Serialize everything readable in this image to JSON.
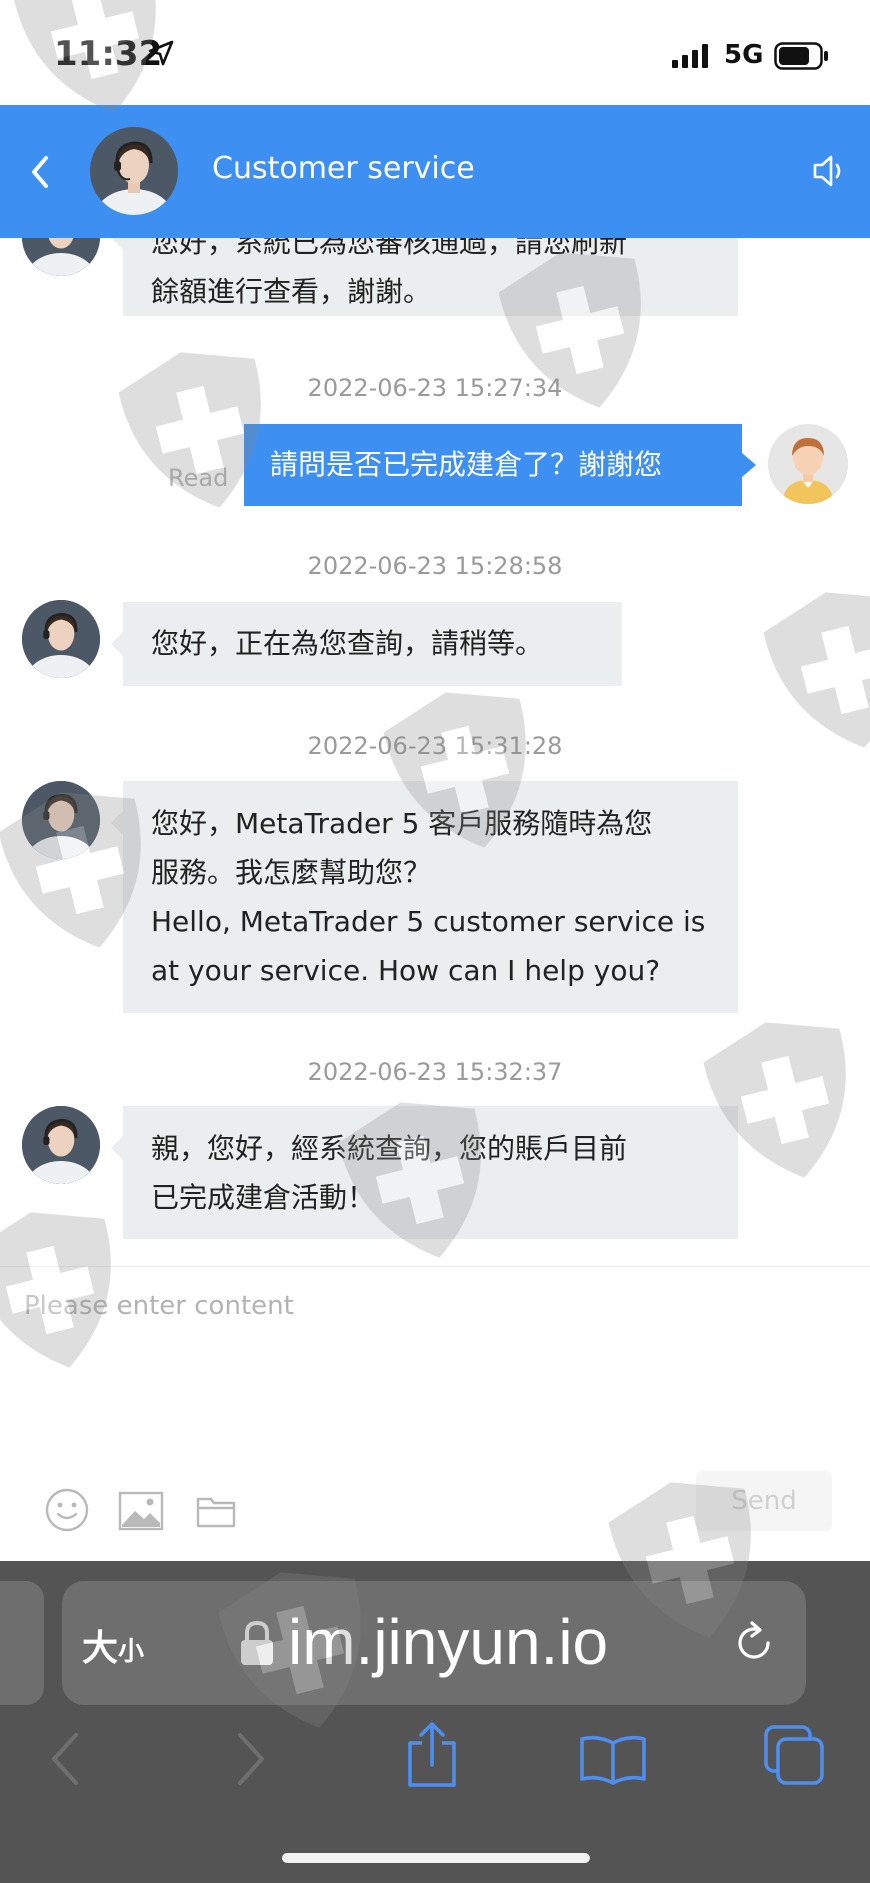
{
  "status_bar": {
    "time": "11:32",
    "network": "5G"
  },
  "header": {
    "title": "Customer service"
  },
  "messages": {
    "m1_line1": "您好，系統已為您審核通過，請您刷新",
    "m1_line2": "餘額進行查看，謝謝。",
    "ts2": "2022-06-23 15:27:34",
    "m2_text": "請問是否已完成建倉了？謝謝您",
    "m2_read": "Read",
    "ts3": "2022-06-23 15:28:58",
    "m3_text": "您好，正在為您查詢，請稍等。",
    "ts4": "2022-06-23 15:31:28",
    "m4_line1": "您好，MetaTrader 5 客戶服務隨時為您",
    "m4_line2": "服務。我怎麼幫助您？",
    "m4_line3": "Hello, MetaTrader 5 customer service is",
    "m4_line4": "at your service. How can I help you?",
    "ts5": "2022-06-23 15:32:37",
    "m5_line1": "親，您好，經系統查詢，您的賬戶目前",
    "m5_line2": "已完成建倉活動！"
  },
  "input": {
    "placeholder": "Please enter content",
    "send_label": "Send"
  },
  "browser": {
    "text_size_big": "大",
    "text_size_small": "小",
    "url": "im.jinyun.io"
  },
  "colors": {
    "accent": "#3d8ff2",
    "incoming_bubble": "#ebeeef",
    "browser_bar": "#545454"
  },
  "icons": [
    "location-arrow-icon",
    "signal-icon",
    "battery-icon",
    "back-icon",
    "speaker-icon",
    "emoji-icon",
    "image-icon",
    "folder-icon",
    "lock-icon",
    "reload-icon",
    "browser-back-icon",
    "browser-forward-icon",
    "share-icon",
    "bookmarks-icon",
    "tabs-icon",
    "shield-cross-watermark"
  ]
}
